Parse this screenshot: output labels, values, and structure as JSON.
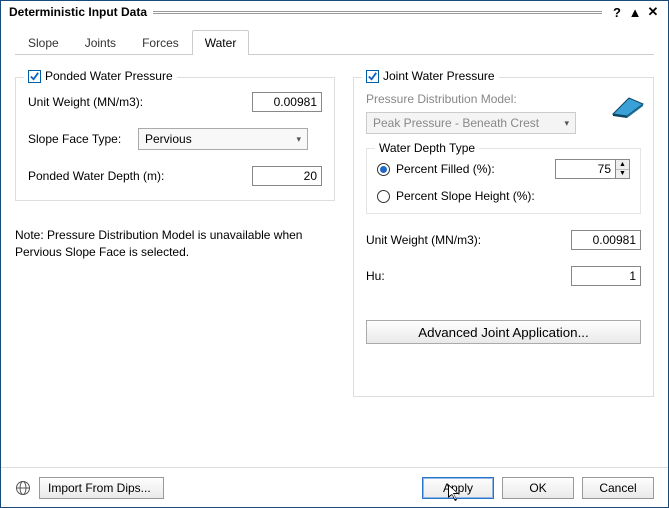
{
  "titlebar": {
    "title": "Deterministic Input Data"
  },
  "tabs": [
    {
      "label": "Slope",
      "active": false
    },
    {
      "label": "Joints",
      "active": false
    },
    {
      "label": "Forces",
      "active": false
    },
    {
      "label": "Water",
      "active": true
    }
  ],
  "left_group": {
    "title": "Ponded Water Pressure",
    "checked": true,
    "unit_weight_label": "Unit Weight (MN/m3):",
    "unit_weight_value": "0.00981",
    "slope_face_type_label": "Slope Face Type:",
    "slope_face_type_value": "Pervious",
    "depth_label": "Ponded Water Depth (m):",
    "depth_value": "20"
  },
  "note": "Note: Pressure Distribution Model is unavailable when Pervious Slope Face is selected.",
  "right_group": {
    "title": "Joint Water Pressure",
    "checked": true,
    "pdm_label": "Pressure Distribution Model:",
    "pdm_value": "Peak Pressure - Beneath Crest",
    "depth_type": {
      "title": "Water Depth Type",
      "percent_filled_label": "Percent Filled (%):",
      "percent_filled_value": "75",
      "percent_slope_label": "Percent Slope Height (%):"
    },
    "unit_weight_label": "Unit Weight (MN/m3):",
    "unit_weight_value": "0.00981",
    "hu_label": "Hu:",
    "hu_value": "1",
    "advanced_label": "Advanced Joint Application..."
  },
  "footer": {
    "import_label": "Import From Dips...",
    "apply": "Apply",
    "ok": "OK",
    "cancel": "Cancel"
  }
}
